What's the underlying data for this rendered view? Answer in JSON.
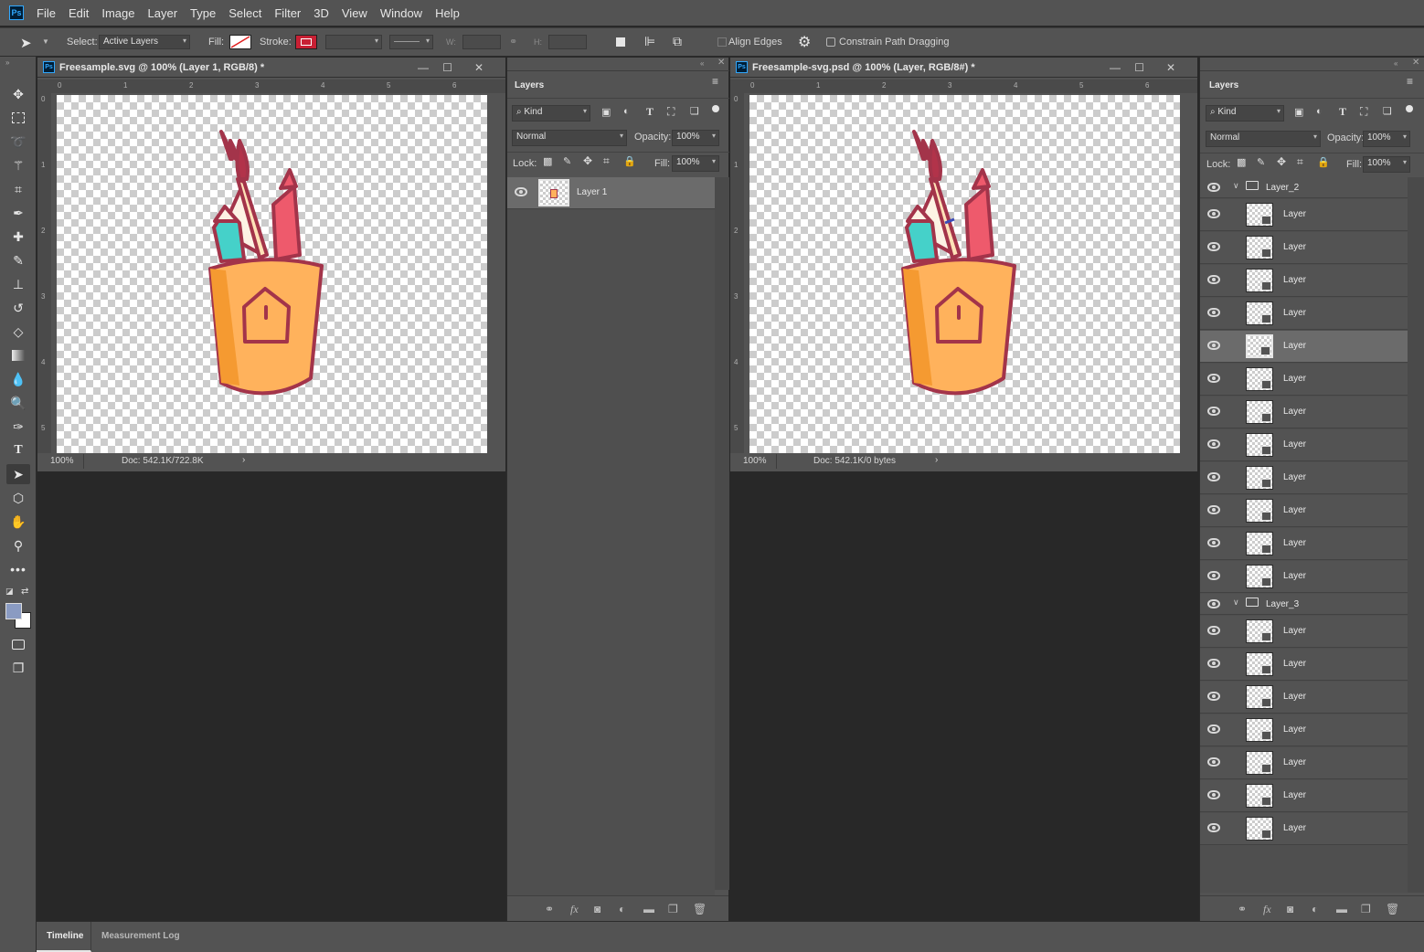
{
  "menu": [
    "File",
    "Edit",
    "Image",
    "Layer",
    "Type",
    "Select",
    "Filter",
    "3D",
    "View",
    "Window",
    "Help"
  ],
  "app_logo": "Ps",
  "options": {
    "select_label": "Select:",
    "select_value": "Active Layers",
    "fill_label": "Fill:",
    "stroke_label": "Stroke:",
    "w_label": "W:",
    "h_label": "H:",
    "align_edges": "Align Edges",
    "constrain": "Constrain Path Dragging"
  },
  "doc1": {
    "title": "Freesample.svg @ 100% (Layer 1, RGB/8) *",
    "zoom": "100%",
    "doc_info": "Doc: 542.1K/722.8K",
    "ruler_h": [
      "0",
      "1",
      "2",
      "3",
      "4",
      "5",
      "6"
    ],
    "ruler_v": [
      "0",
      "1",
      "2",
      "3",
      "4",
      "5"
    ]
  },
  "doc2": {
    "title": "Freesample-svg.psd @ 100% (Layer, RGB/8#) *",
    "zoom": "100%",
    "doc_info": "Doc: 542.1K/0 bytes",
    "ruler_h": [
      "0",
      "1",
      "2",
      "3",
      "4",
      "5",
      "6"
    ],
    "ruler_v": [
      "0",
      "1",
      "2",
      "3",
      "4",
      "5"
    ]
  },
  "layers1": {
    "tab": "Layers",
    "kind": "Kind",
    "blend": "Normal",
    "opacity_label": "Opacity:",
    "opacity": "100%",
    "lock_label": "Lock:",
    "fill_label": "Fill:",
    "fill": "100%",
    "layers": [
      "Layer 1"
    ]
  },
  "layers2": {
    "tab": "Layers",
    "kind": "Kind",
    "blend": "Normal",
    "opacity_label": "Opacity:",
    "opacity": "100%",
    "lock_label": "Lock:",
    "fill_label": "Fill:",
    "fill": "100%",
    "group1": "Layer_2",
    "group1_layers": [
      "Layer",
      "Layer",
      "Layer",
      "Layer",
      "Layer",
      "Layer",
      "Layer",
      "Layer",
      "Layer",
      "Layer",
      "Layer",
      "Layer"
    ],
    "group2": "Layer_3",
    "group2_layers": [
      "Layer",
      "Layer",
      "Layer",
      "Layer",
      "Layer",
      "Layer",
      "Layer"
    ]
  },
  "bottom_tabs": [
    "Timeline",
    "Measurement Log"
  ],
  "colors": {
    "accent": "#31a8ff",
    "cup": "#ffb25c",
    "outline": "#a3344a",
    "pencil": "#ee5a6c",
    "teal": "#45d1c9"
  }
}
